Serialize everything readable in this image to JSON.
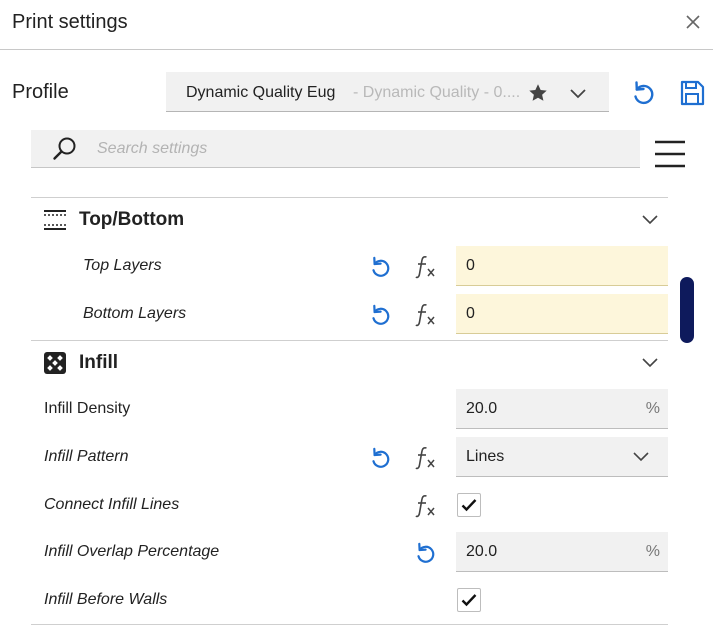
{
  "window": {
    "title": "Print settings"
  },
  "profile": {
    "label": "Profile",
    "name": "Dynamic Quality Eug",
    "subtitle": "- Dynamic Quality - 0...."
  },
  "search": {
    "placeholder": "Search settings"
  },
  "categories": [
    {
      "title": "Top/Bottom",
      "icon": "top-bottom-icon",
      "settings": [
        {
          "label": "Top Layers",
          "value": "0"
        },
        {
          "label": "Bottom Layers",
          "value": "0"
        }
      ]
    },
    {
      "title": "Infill",
      "icon": "infill-icon",
      "settings": [
        {
          "label": "Infill Density",
          "value": "20.0",
          "unit": "%"
        },
        {
          "label": "Infill Pattern",
          "value": "Lines"
        },
        {
          "label": "Connect Infill Lines",
          "checked": true
        },
        {
          "label": "Infill Overlap Percentage",
          "value": "20.0",
          "unit": "%"
        },
        {
          "label": "Infill Before Walls",
          "checked": true
        }
      ]
    }
  ],
  "colors": {
    "accent": "#1f6fd1",
    "override_field": "#fdf6db",
    "field": "#f1f1f1",
    "scrollbar": "#0e1a5c"
  }
}
